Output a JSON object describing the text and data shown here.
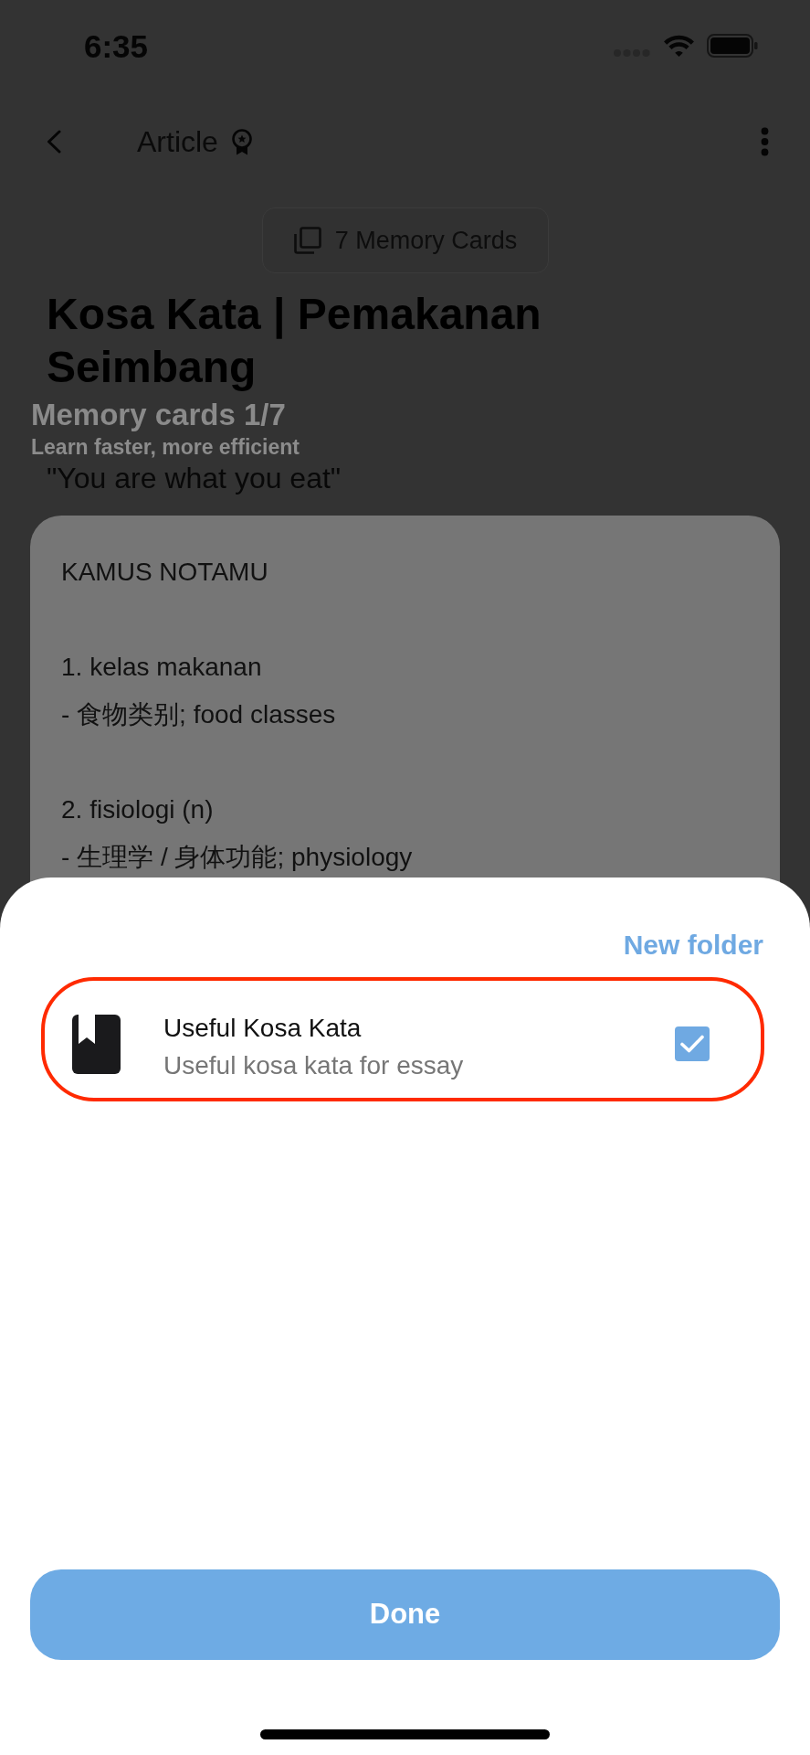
{
  "status_bar": {
    "time": "6:35"
  },
  "header": {
    "title": "Article"
  },
  "memory_cards_button": {
    "label": "7 Memory Cards"
  },
  "article": {
    "title": "Kosa Kata | Pemakanan Seimbang",
    "quote": "\"You are what you eat\"",
    "card_paragraphs": [
      [
        "KAMUS NOTAMU"
      ],
      [
        "1. kelas makanan",
        "- 食物类别; food classes"
      ],
      [
        "2. fisiologi (n)",
        "- 生理学 / 身体功能; physiology"
      ]
    ]
  },
  "memory_cards_overlay": {
    "title": "Memory cards 1/7",
    "subtitle": "Learn faster, more efficient"
  },
  "folder_sheet": {
    "new_folder": "New folder",
    "folders": [
      {
        "name": "Useful Kosa Kata",
        "description": "Useful kosa kata for essay",
        "checked": true
      }
    ],
    "done": "Done"
  }
}
